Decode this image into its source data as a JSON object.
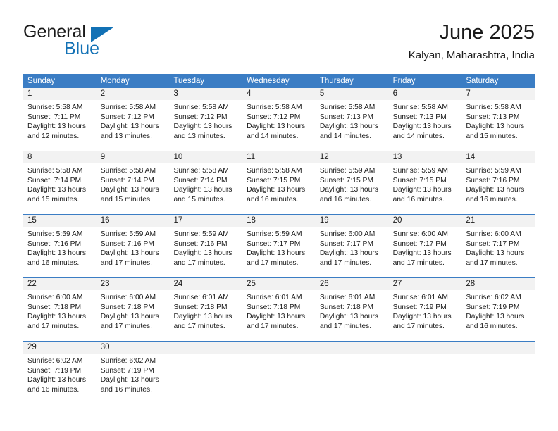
{
  "brand": {
    "name_part1": "General",
    "name_part2": "Blue",
    "triangle_icon": "triangle-icon",
    "accent_color": "#1271b5"
  },
  "header": {
    "title": "June 2025",
    "location": "Kalyan, Maharashtra, India"
  },
  "colors": {
    "header_blue": "#3b7dc4",
    "daynum_gray": "#f2f2f2",
    "text": "#1a1a1a"
  },
  "weekdays": [
    "Sunday",
    "Monday",
    "Tuesday",
    "Wednesday",
    "Thursday",
    "Friday",
    "Saturday"
  ],
  "weeks": [
    [
      {
        "day": "1",
        "sunrise": "Sunrise: 5:58 AM",
        "sunset": "Sunset: 7:11 PM",
        "daylight_line1": "Daylight: 13 hours",
        "daylight_line2": "and 12 minutes."
      },
      {
        "day": "2",
        "sunrise": "Sunrise: 5:58 AM",
        "sunset": "Sunset: 7:12 PM",
        "daylight_line1": "Daylight: 13 hours",
        "daylight_line2": "and 13 minutes."
      },
      {
        "day": "3",
        "sunrise": "Sunrise: 5:58 AM",
        "sunset": "Sunset: 7:12 PM",
        "daylight_line1": "Daylight: 13 hours",
        "daylight_line2": "and 13 minutes."
      },
      {
        "day": "4",
        "sunrise": "Sunrise: 5:58 AM",
        "sunset": "Sunset: 7:12 PM",
        "daylight_line1": "Daylight: 13 hours",
        "daylight_line2": "and 14 minutes."
      },
      {
        "day": "5",
        "sunrise": "Sunrise: 5:58 AM",
        "sunset": "Sunset: 7:13 PM",
        "daylight_line1": "Daylight: 13 hours",
        "daylight_line2": "and 14 minutes."
      },
      {
        "day": "6",
        "sunrise": "Sunrise: 5:58 AM",
        "sunset": "Sunset: 7:13 PM",
        "daylight_line1": "Daylight: 13 hours",
        "daylight_line2": "and 14 minutes."
      },
      {
        "day": "7",
        "sunrise": "Sunrise: 5:58 AM",
        "sunset": "Sunset: 7:13 PM",
        "daylight_line1": "Daylight: 13 hours",
        "daylight_line2": "and 15 minutes."
      }
    ],
    [
      {
        "day": "8",
        "sunrise": "Sunrise: 5:58 AM",
        "sunset": "Sunset: 7:14 PM",
        "daylight_line1": "Daylight: 13 hours",
        "daylight_line2": "and 15 minutes."
      },
      {
        "day": "9",
        "sunrise": "Sunrise: 5:58 AM",
        "sunset": "Sunset: 7:14 PM",
        "daylight_line1": "Daylight: 13 hours",
        "daylight_line2": "and 15 minutes."
      },
      {
        "day": "10",
        "sunrise": "Sunrise: 5:58 AM",
        "sunset": "Sunset: 7:14 PM",
        "daylight_line1": "Daylight: 13 hours",
        "daylight_line2": "and 15 minutes."
      },
      {
        "day": "11",
        "sunrise": "Sunrise: 5:58 AM",
        "sunset": "Sunset: 7:15 PM",
        "daylight_line1": "Daylight: 13 hours",
        "daylight_line2": "and 16 minutes."
      },
      {
        "day": "12",
        "sunrise": "Sunrise: 5:59 AM",
        "sunset": "Sunset: 7:15 PM",
        "daylight_line1": "Daylight: 13 hours",
        "daylight_line2": "and 16 minutes."
      },
      {
        "day": "13",
        "sunrise": "Sunrise: 5:59 AM",
        "sunset": "Sunset: 7:15 PM",
        "daylight_line1": "Daylight: 13 hours",
        "daylight_line2": "and 16 minutes."
      },
      {
        "day": "14",
        "sunrise": "Sunrise: 5:59 AM",
        "sunset": "Sunset: 7:16 PM",
        "daylight_line1": "Daylight: 13 hours",
        "daylight_line2": "and 16 minutes."
      }
    ],
    [
      {
        "day": "15",
        "sunrise": "Sunrise: 5:59 AM",
        "sunset": "Sunset: 7:16 PM",
        "daylight_line1": "Daylight: 13 hours",
        "daylight_line2": "and 16 minutes."
      },
      {
        "day": "16",
        "sunrise": "Sunrise: 5:59 AM",
        "sunset": "Sunset: 7:16 PM",
        "daylight_line1": "Daylight: 13 hours",
        "daylight_line2": "and 17 minutes."
      },
      {
        "day": "17",
        "sunrise": "Sunrise: 5:59 AM",
        "sunset": "Sunset: 7:16 PM",
        "daylight_line1": "Daylight: 13 hours",
        "daylight_line2": "and 17 minutes."
      },
      {
        "day": "18",
        "sunrise": "Sunrise: 5:59 AM",
        "sunset": "Sunset: 7:17 PM",
        "daylight_line1": "Daylight: 13 hours",
        "daylight_line2": "and 17 minutes."
      },
      {
        "day": "19",
        "sunrise": "Sunrise: 6:00 AM",
        "sunset": "Sunset: 7:17 PM",
        "daylight_line1": "Daylight: 13 hours",
        "daylight_line2": "and 17 minutes."
      },
      {
        "day": "20",
        "sunrise": "Sunrise: 6:00 AM",
        "sunset": "Sunset: 7:17 PM",
        "daylight_line1": "Daylight: 13 hours",
        "daylight_line2": "and 17 minutes."
      },
      {
        "day": "21",
        "sunrise": "Sunrise: 6:00 AM",
        "sunset": "Sunset: 7:17 PM",
        "daylight_line1": "Daylight: 13 hours",
        "daylight_line2": "and 17 minutes."
      }
    ],
    [
      {
        "day": "22",
        "sunrise": "Sunrise: 6:00 AM",
        "sunset": "Sunset: 7:18 PM",
        "daylight_line1": "Daylight: 13 hours",
        "daylight_line2": "and 17 minutes."
      },
      {
        "day": "23",
        "sunrise": "Sunrise: 6:00 AM",
        "sunset": "Sunset: 7:18 PM",
        "daylight_line1": "Daylight: 13 hours",
        "daylight_line2": "and 17 minutes."
      },
      {
        "day": "24",
        "sunrise": "Sunrise: 6:01 AM",
        "sunset": "Sunset: 7:18 PM",
        "daylight_line1": "Daylight: 13 hours",
        "daylight_line2": "and 17 minutes."
      },
      {
        "day": "25",
        "sunrise": "Sunrise: 6:01 AM",
        "sunset": "Sunset: 7:18 PM",
        "daylight_line1": "Daylight: 13 hours",
        "daylight_line2": "and 17 minutes."
      },
      {
        "day": "26",
        "sunrise": "Sunrise: 6:01 AM",
        "sunset": "Sunset: 7:18 PM",
        "daylight_line1": "Daylight: 13 hours",
        "daylight_line2": "and 17 minutes."
      },
      {
        "day": "27",
        "sunrise": "Sunrise: 6:01 AM",
        "sunset": "Sunset: 7:19 PM",
        "daylight_line1": "Daylight: 13 hours",
        "daylight_line2": "and 17 minutes."
      },
      {
        "day": "28",
        "sunrise": "Sunrise: 6:02 AM",
        "sunset": "Sunset: 7:19 PM",
        "daylight_line1": "Daylight: 13 hours",
        "daylight_line2": "and 16 minutes."
      }
    ],
    [
      {
        "day": "29",
        "sunrise": "Sunrise: 6:02 AM",
        "sunset": "Sunset: 7:19 PM",
        "daylight_line1": "Daylight: 13 hours",
        "daylight_line2": "and 16 minutes."
      },
      {
        "day": "30",
        "sunrise": "Sunrise: 6:02 AM",
        "sunset": "Sunset: 7:19 PM",
        "daylight_line1": "Daylight: 13 hours",
        "daylight_line2": "and 16 minutes."
      },
      {
        "day": "",
        "sunrise": "",
        "sunset": "",
        "daylight_line1": "",
        "daylight_line2": ""
      },
      {
        "day": "",
        "sunrise": "",
        "sunset": "",
        "daylight_line1": "",
        "daylight_line2": ""
      },
      {
        "day": "",
        "sunrise": "",
        "sunset": "",
        "daylight_line1": "",
        "daylight_line2": ""
      },
      {
        "day": "",
        "sunrise": "",
        "sunset": "",
        "daylight_line1": "",
        "daylight_line2": ""
      },
      {
        "day": "",
        "sunrise": "",
        "sunset": "",
        "daylight_line1": "",
        "daylight_line2": ""
      }
    ]
  ]
}
